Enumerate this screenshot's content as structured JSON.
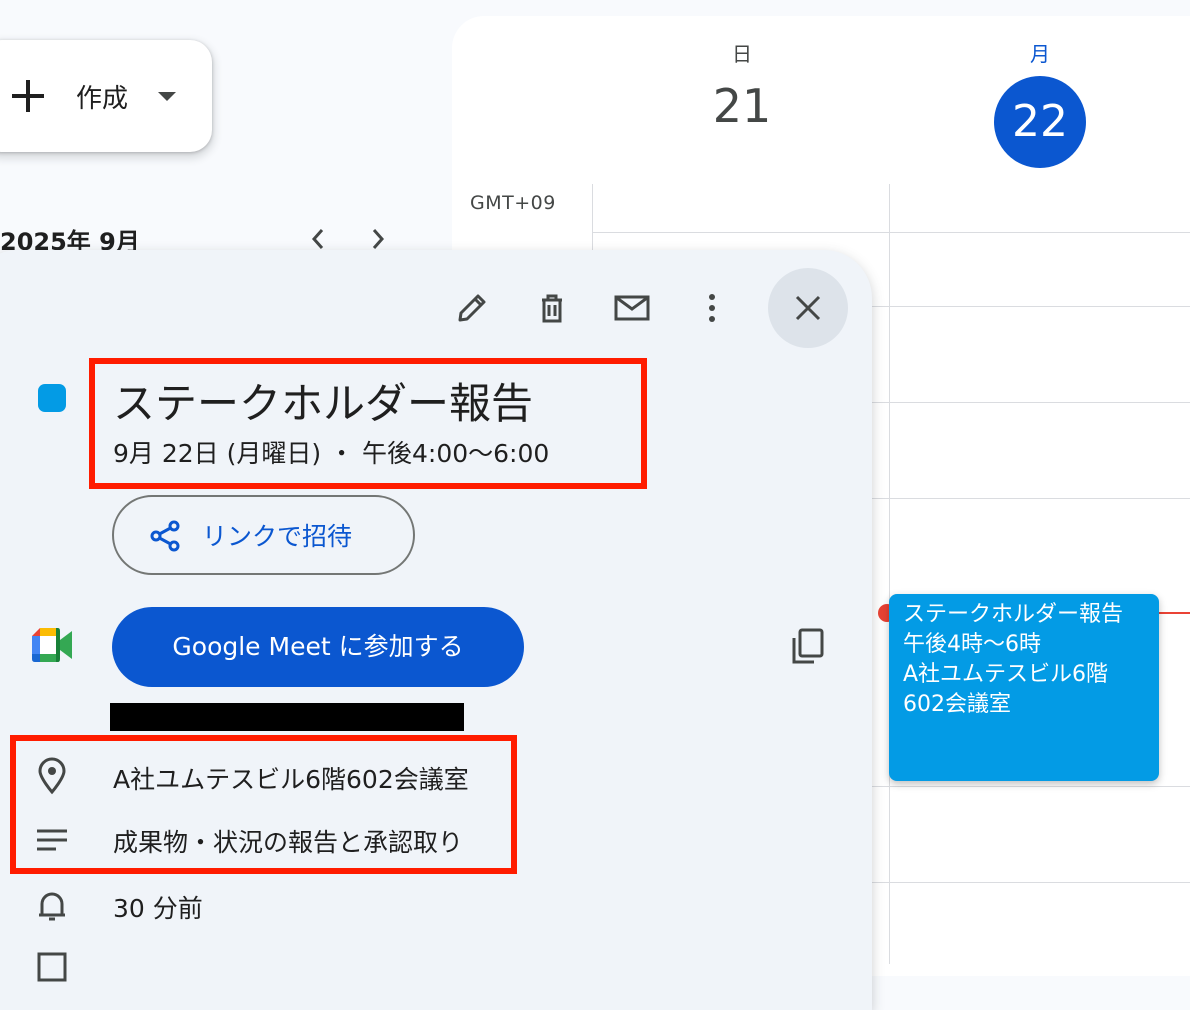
{
  "create": {
    "label": "作成"
  },
  "mini_calendar": {
    "title": "2025年 9月",
    "prev": "‹",
    "next": "›"
  },
  "calendar": {
    "timezone": "GMT+09",
    "days": [
      {
        "dow": "日",
        "date": "21"
      },
      {
        "dow": "月",
        "date": "22",
        "today": true
      }
    ],
    "event_block": {
      "title": "ステークホルダー報告",
      "time": "午後4時〜6時",
      "location_line1": "A社ユムテスビル6階",
      "location_line2": "602会議室",
      "color": "#039be5"
    }
  },
  "popover": {
    "title": "ステークホルダー報告",
    "datetime": "9月 22日 (月曜日) ・ 午後4:00〜6:00",
    "invite_button": "リンクで招待",
    "meet_button": "Google Meet に参加する",
    "location": "A社ユムテスビル6階602会議室",
    "description": "成果物・状況の報告と承認取り",
    "reminder": "30 分前",
    "event_color": "#039be5"
  },
  "colors": {
    "accent": "#0b57d0",
    "highlight_box": "#ff1c00",
    "now_line": "#ea4335"
  }
}
